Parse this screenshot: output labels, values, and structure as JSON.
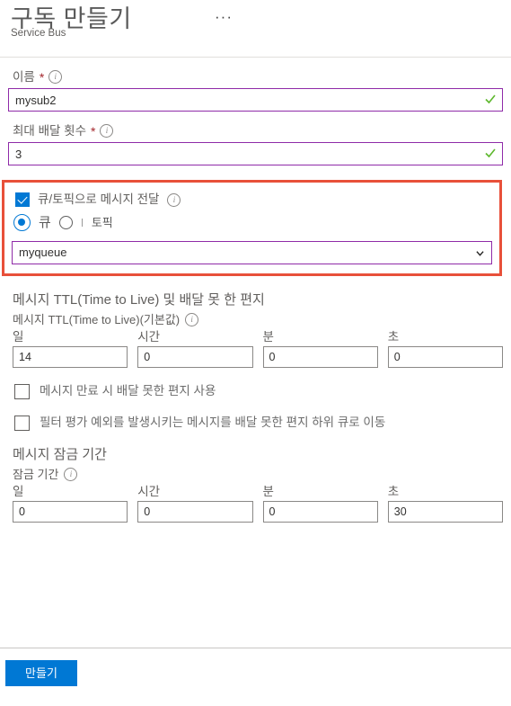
{
  "header": {
    "title": "구독 만들기",
    "subtitle": "Service Bus",
    "more_menu": "···"
  },
  "form": {
    "name": {
      "label": "이름",
      "required_marker": "*",
      "info_icon": "info-icon",
      "value": "mysub2",
      "placeholder": "",
      "validation_icon": "checkmark-icon"
    },
    "max_delivery_count": {
      "label": "최대 배달 횟수",
      "required_marker": "*",
      "info_icon": "info-icon",
      "value": "3",
      "placeholder": "",
      "validation_icon": "checkmark-icon"
    },
    "forwarding": {
      "checkbox_label": "큐/토픽으로 메시지 전달",
      "checkbox_checked": true,
      "info_icon": "info-icon",
      "radio_queue_label": "큐",
      "radio_topic_label": "토픽",
      "radio_selected": "큐",
      "destination_value": "myqueue",
      "dropdown_icon": "chevron-down-icon",
      "highlight_color": "#e8503a"
    },
    "ttl_section": {
      "title": "메시지 TTL(Time to Live) 및 배달 못 한 편지",
      "sub_label": "메시지 TTL(Time to Live)(기본값)",
      "info_icon": "info-icon",
      "fields": [
        {
          "label": "일",
          "value": "14"
        },
        {
          "label": "시간",
          "value": "0"
        },
        {
          "label": "분",
          "value": "0"
        },
        {
          "label": "초",
          "value": "0"
        }
      ],
      "options": [
        {
          "label": "메시지 만료 시 배달 못한 편지 사용",
          "checked": false
        },
        {
          "label": "필터 평가 예외를 발생시키는 메시지를 배달 못한 편지 하위 큐로 이동",
          "checked": false
        }
      ]
    },
    "lock_section": {
      "title": "메시지 잠금 기간",
      "sub_label": "잠금 기간",
      "info_icon": "info-icon",
      "fields": [
        {
          "label": "일",
          "value": "0"
        },
        {
          "label": "시간",
          "value": "0"
        },
        {
          "label": "분",
          "value": "0"
        },
        {
          "label": "초",
          "value": "30"
        }
      ]
    }
  },
  "footer": {
    "create_label": "만들기"
  },
  "colors": {
    "accent_blue": "#0078d4",
    "input_border_purple": "#8f2ba8",
    "valid_green": "#5eb82e",
    "highlight_red": "#e8503a"
  }
}
